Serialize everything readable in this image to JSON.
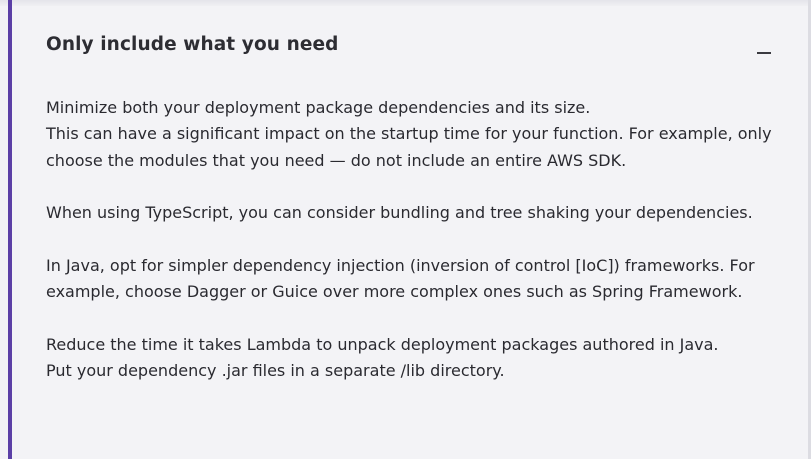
{
  "section": {
    "title": "Only include what you need",
    "collapse_icon": "minus-icon"
  },
  "paragraphs": [
    {
      "lines": [
        "Minimize both your deployment package dependencies and its size.",
        "This can have a significant impact on the startup time for your function. For example, only choose the modules that you need — do not include an entire AWS SDK."
      ]
    },
    {
      "lines": [
        "When using TypeScript, you can consider bundling and tree shaking your dependencies."
      ]
    },
    {
      "lines": [
        "In Java, opt for simpler dependency injection (inversion of control [IoC]) frameworks. For example, choose Dagger or Guice over more complex ones such as Spring Framework."
      ]
    },
    {
      "lines": [
        "Reduce the time it takes Lambda to unpack deployment packages authored in Java.",
        "Put your dependency .jar files in a separate /lib directory."
      ]
    }
  ],
  "colors": {
    "accent": "#5b3fa6",
    "background": "#f3f3f6",
    "text": "#2a2a30"
  }
}
